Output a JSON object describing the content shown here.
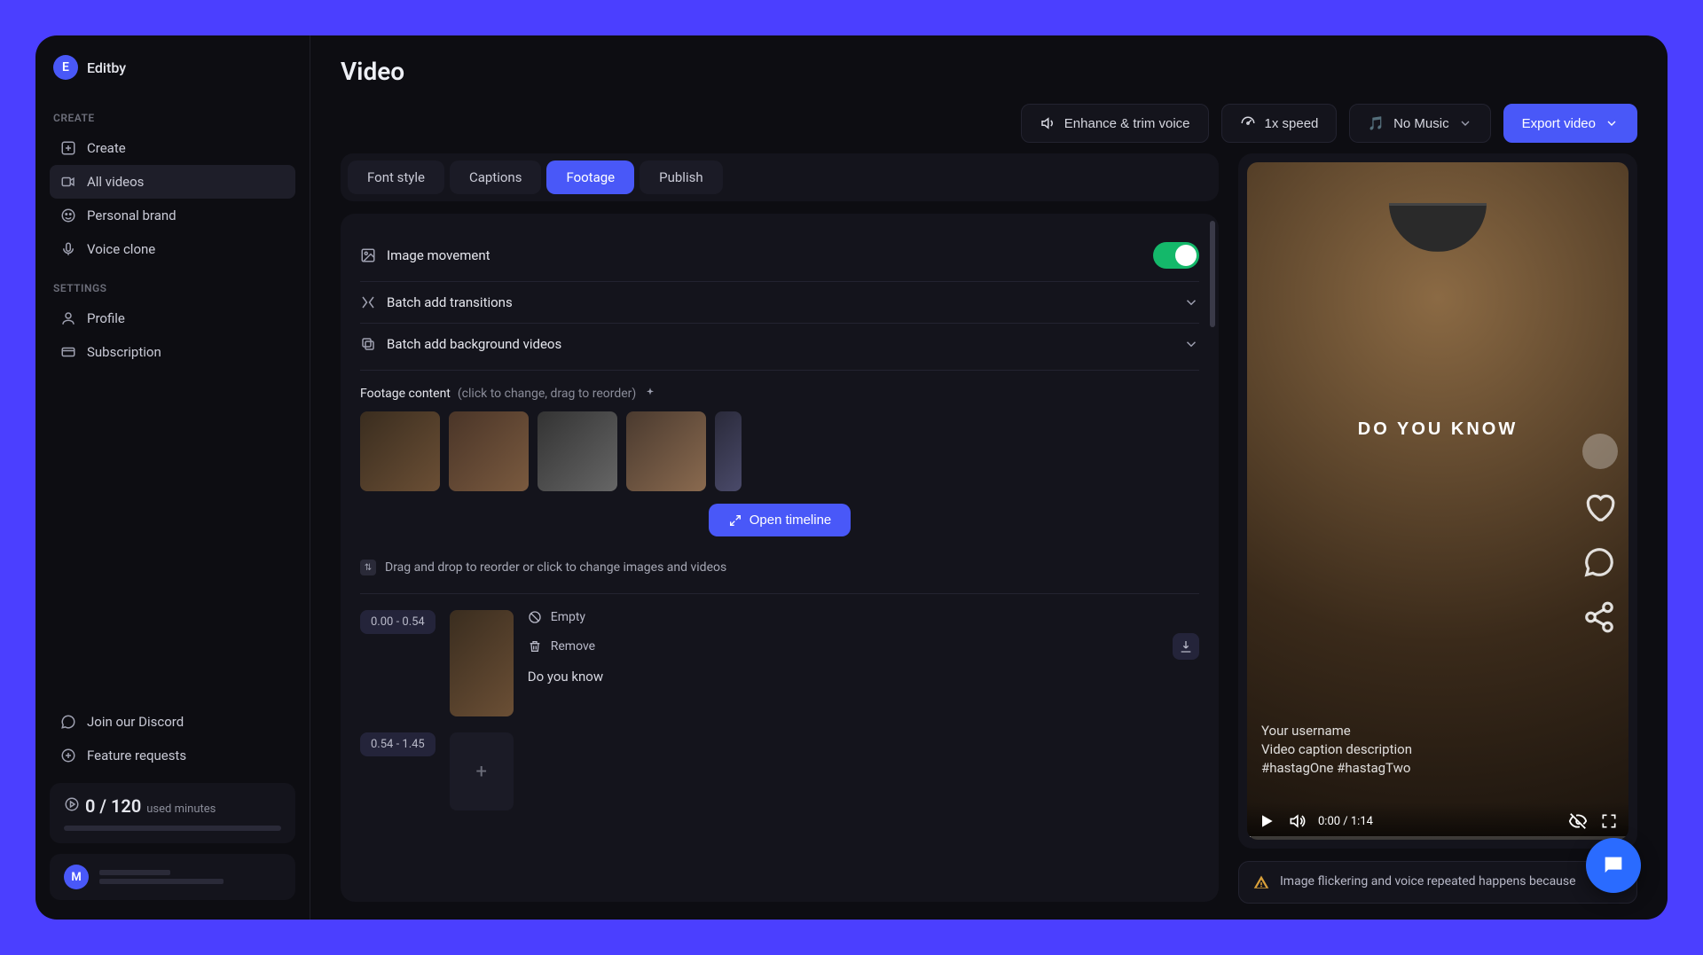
{
  "brand": {
    "initial": "E",
    "name": "Editby"
  },
  "sidebar": {
    "sections": {
      "create_label": "CREATE",
      "settings_label": "SETTINGS"
    },
    "create": [
      {
        "label": "Create"
      },
      {
        "label": "All videos"
      },
      {
        "label": "Personal brand"
      },
      {
        "label": "Voice clone"
      }
    ],
    "settings": [
      {
        "label": "Profile"
      },
      {
        "label": "Subscription"
      }
    ],
    "footer": [
      {
        "label": "Join our Discord"
      },
      {
        "label": "Feature requests"
      }
    ]
  },
  "usage": {
    "count": "0 / 120",
    "unit": "used minutes",
    "percent": 0
  },
  "user": {
    "initial": "M"
  },
  "page": {
    "title": "Video"
  },
  "toolbar": {
    "enhance": "Enhance & trim voice",
    "speed": "1x speed",
    "music": "No Music",
    "music_icon": "🎵",
    "export": "Export video"
  },
  "tabs": [
    {
      "label": "Font style"
    },
    {
      "label": "Captions"
    },
    {
      "label": "Footage"
    },
    {
      "label": "Publish"
    }
  ],
  "panel": {
    "image_movement": "Image movement",
    "batch_transitions": "Batch add transitions",
    "batch_bg": "Batch add background videos",
    "footage_content": "Footage content",
    "footage_hint": "(click to change, drag to reorder)",
    "open_timeline": "Open timeline",
    "reorder_hint": "Drag and drop to reorder or click to change images and videos"
  },
  "segments": [
    {
      "time": "0.00 - 0.54",
      "empty": "Empty",
      "remove": "Remove",
      "caption": "Do you know"
    },
    {
      "time": "0.54 - 1.45"
    }
  ],
  "preview": {
    "caption": "DO YOU KNOW",
    "username": "Your username",
    "description": "Video caption description",
    "hashtags": "#hastagOne #hastagTwo",
    "time": "0:00 / 1:14"
  },
  "notice": "Image flickering and voice repeated happens because"
}
